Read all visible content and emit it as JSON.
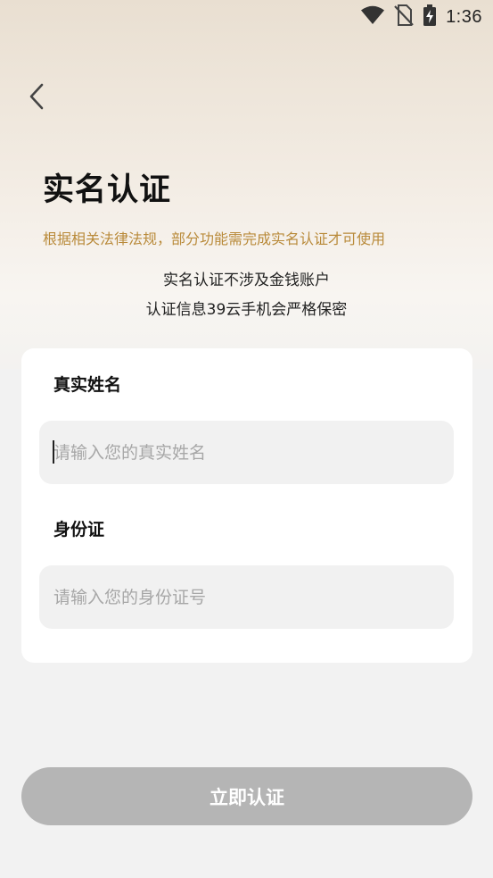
{
  "status_bar": {
    "time": "1:36",
    "icons": [
      "wifi-icon",
      "no-sim-icon",
      "battery-charging-icon"
    ]
  },
  "header": {
    "back_icon": "chevron-left-icon",
    "title": "实名认证",
    "notice": "根据相关法律法规，部分功能需完成实名认证才可使用",
    "info_line1": "实名认证不涉及金钱账户",
    "info_line2": "认证信息39云手机会严格保密"
  },
  "form": {
    "name_label": "真实姓名",
    "name_placeholder": "请输入您的真实姓名",
    "name_value": "",
    "id_label": "身份证",
    "id_placeholder": "请输入您的身份证号",
    "id_value": ""
  },
  "submit_label": "立即认证",
  "colors": {
    "notice": "#b98a3a",
    "button_disabled": "#b5b5b5",
    "input_bg": "#f1f1f1",
    "page_bg": "#f2f2f2"
  }
}
